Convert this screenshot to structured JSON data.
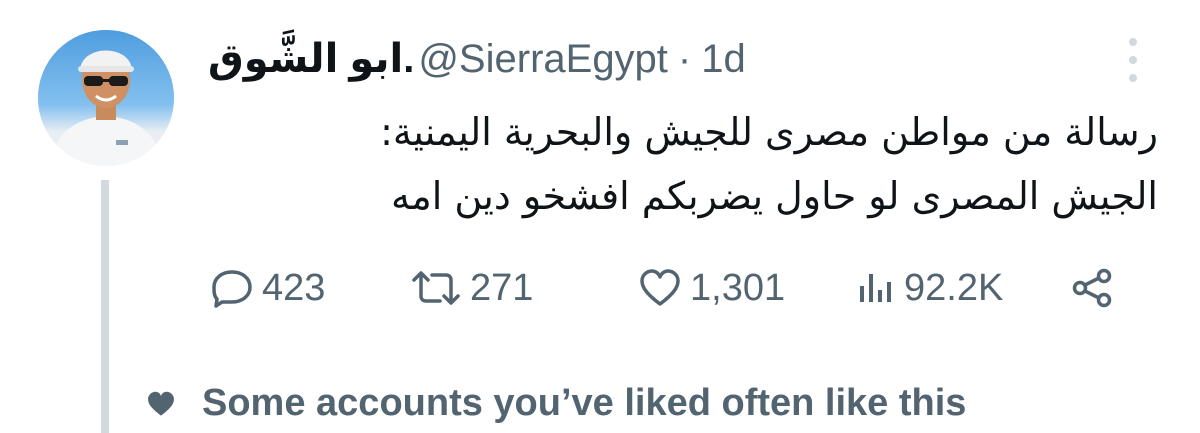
{
  "tweet": {
    "display_name": "ابو الشَّوق.",
    "handle": "@SierraEgypt",
    "separator": "·",
    "time": "1d",
    "text_lines": [
      "رسالة من مواطن مصرى للجيش والبحرية اليمنية:",
      "الجيش المصرى لو حاول يضربكم افشخو دين امه"
    ]
  },
  "actions": {
    "replies": "423",
    "retweets": "271",
    "likes": "1,301",
    "views": "92.2K"
  },
  "icons": {
    "reply": "reply-icon",
    "retweet": "retweet-icon",
    "like": "heart-icon",
    "views": "views-icon",
    "share": "share-icon",
    "more": "more-icon",
    "footer": "heart-icon"
  },
  "footer": {
    "text": "Some accounts you’ve liked often like this"
  },
  "colors": {
    "text_primary": "#0f1419",
    "text_secondary": "#536471",
    "thread_line": "#cfd9de",
    "background": "#ffffff"
  }
}
